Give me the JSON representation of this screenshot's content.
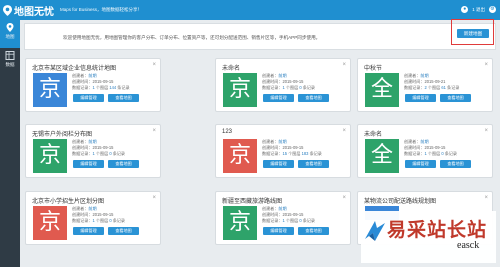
{
  "header": {
    "app_name": "地图无忧",
    "tagline": "Maps for Business，地图数据轻松分享！",
    "user": "1 退出"
  },
  "sidebar": {
    "items": [
      {
        "label": "地图",
        "active": true,
        "icon": "map-icon"
      },
      {
        "label": "数据",
        "active": false,
        "icon": "data-icon"
      }
    ]
  },
  "notice": {
    "text": "欢迎使用地图无忧，用地图管理你的客户分布、订单分布、位置资产等，还可划分配送范围、销售片区等，手机APP同步使用。"
  },
  "toolbar": {
    "new_map_label": "新建地图"
  },
  "labels": {
    "creator": "创建者：",
    "created_at": "创建时间：",
    "points_prefix": "数据记录：",
    "points_mid": " 个图层 ",
    "points_suffix": " 条记录",
    "edit": "编辑管理",
    "view": "查看地图"
  },
  "cards": [
    {
      "title": "北京市某区域企业信息统计地图",
      "char": "京",
      "color": "#3a86d8",
      "creator": "前期",
      "date": "2015-09-15",
      "layers": "1",
      "records": "144"
    },
    {
      "title": "未命名",
      "char": "京",
      "color": "#2ea36a",
      "creator": "前期",
      "date": "2015-09-15",
      "layers": "1",
      "records": "0"
    },
    {
      "title": "中秋节",
      "char": "全",
      "color": "#2ea36a",
      "creator": "前期",
      "date": "2015-09-21",
      "layers": "2",
      "records": "61"
    },
    {
      "title": "无锡市户外阅栏分布图",
      "char": "京",
      "color": "#2ea36a",
      "creator": "前期",
      "date": "2015-09-15",
      "layers": "1",
      "records": "0"
    },
    {
      "title": "123",
      "char": "京",
      "color": "#e05a4f",
      "creator": "前期",
      "date": "2015-09-15",
      "layers": "15",
      "records": "183"
    },
    {
      "title": "未命名",
      "char": "全",
      "color": "#2ea36a",
      "creator": "前期",
      "date": "2015-09-15",
      "layers": "1",
      "records": "0"
    },
    {
      "title": "北京市小学招生片区划分图",
      "char": "京",
      "color": "#e05a4f",
      "creator": "前期",
      "date": "2015-09-15",
      "layers": "1",
      "records": "0"
    },
    {
      "title": "新疆至西藏旅游路线图",
      "char": "京",
      "color": "#2ea36a",
      "creator": "前期",
      "date": "2015-09-15",
      "layers": "1",
      "records": "0"
    },
    {
      "title": "某物流公司配送路线规划图",
      "char": "",
      "color": "#3a86d8",
      "creator": "",
      "date": "",
      "layers": "",
      "records": ""
    }
  ],
  "watermark": {
    "text": "易采站长站",
    "url": "easck"
  }
}
